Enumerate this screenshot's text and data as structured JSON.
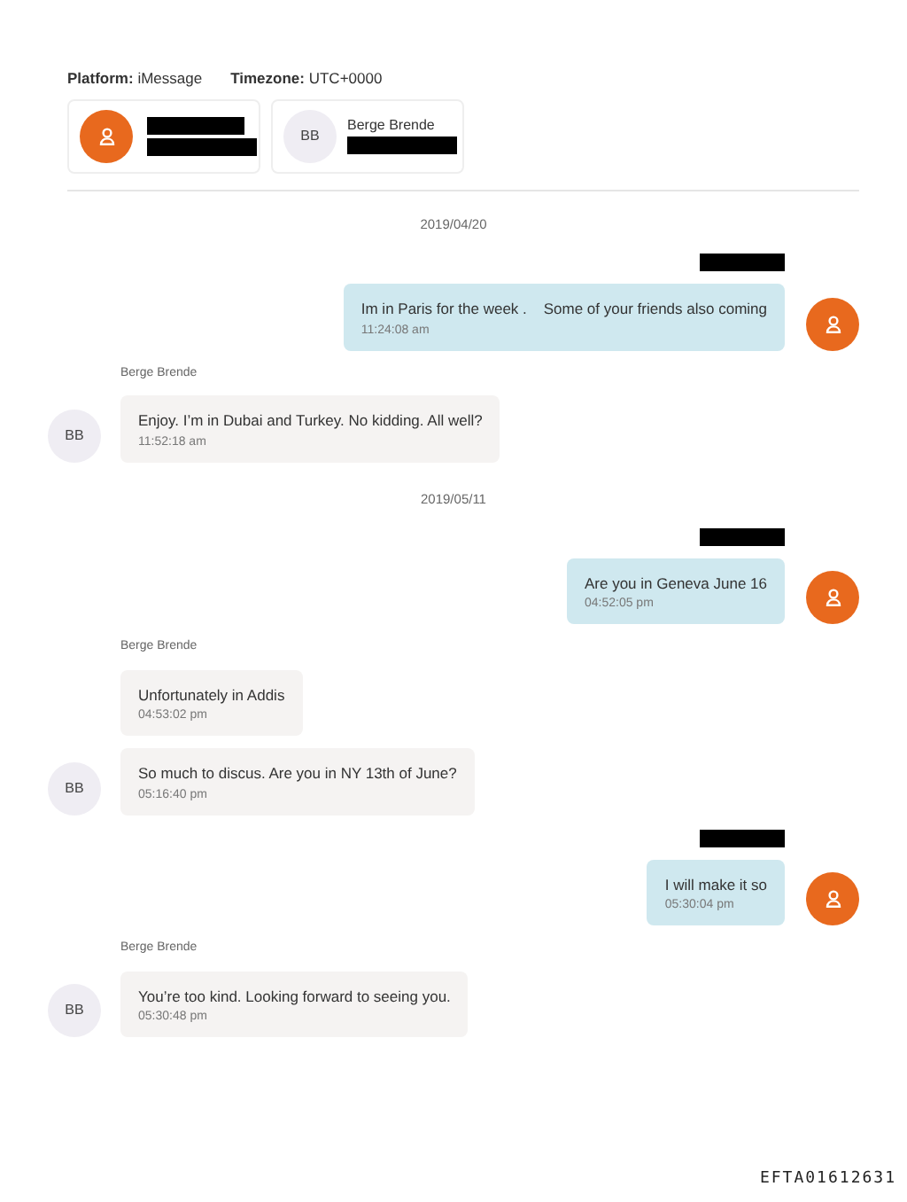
{
  "header": {
    "platform_label": "Platform:",
    "platform": "iMessage",
    "timezone_label": "Timezone:",
    "timezone": "UTC+0000"
  },
  "participants": [
    {
      "kind": "owner"
    },
    {
      "kind": "contact",
      "initials": "BB",
      "name": "Berge Brende"
    }
  ],
  "thread": [
    {
      "kind": "date",
      "text": "2019/04/20"
    },
    {
      "kind": "outgoing",
      "messages": [
        {
          "text": "Im in Paris for the week .    Some of your friends also coming",
          "time": "11:24:08 am"
        }
      ]
    },
    {
      "kind": "incoming",
      "sender": "Berge Brende",
      "initials": "BB",
      "messages": [
        {
          "text": "Enjoy. I’m in Dubai and Turkey. No kidding. All well?",
          "time": "11:52:18 am"
        }
      ]
    },
    {
      "kind": "date",
      "text": "2019/05/11"
    },
    {
      "kind": "outgoing",
      "messages": [
        {
          "text": "Are you in Geneva June 16",
          "time": "04:52:05 pm"
        }
      ]
    },
    {
      "kind": "incoming",
      "sender": "Berge Brende",
      "initials": "BB",
      "messages": [
        {
          "text": "Unfortunately in Addis",
          "time": "04:53:02 pm"
        },
        {
          "text": "So much to discus. Are you in NY 13th of June?",
          "time": "05:16:40 pm"
        }
      ]
    },
    {
      "kind": "outgoing",
      "messages": [
        {
          "text": "I will make it so",
          "time": "05:30:04 pm"
        }
      ]
    },
    {
      "kind": "incoming",
      "sender": "Berge Brende",
      "initials": "BB",
      "messages": [
        {
          "text": "You’re too kind. Looking forward to seeing you.",
          "time": "05:30:48 pm"
        }
      ]
    }
  ],
  "footer": "EFTA01612631"
}
